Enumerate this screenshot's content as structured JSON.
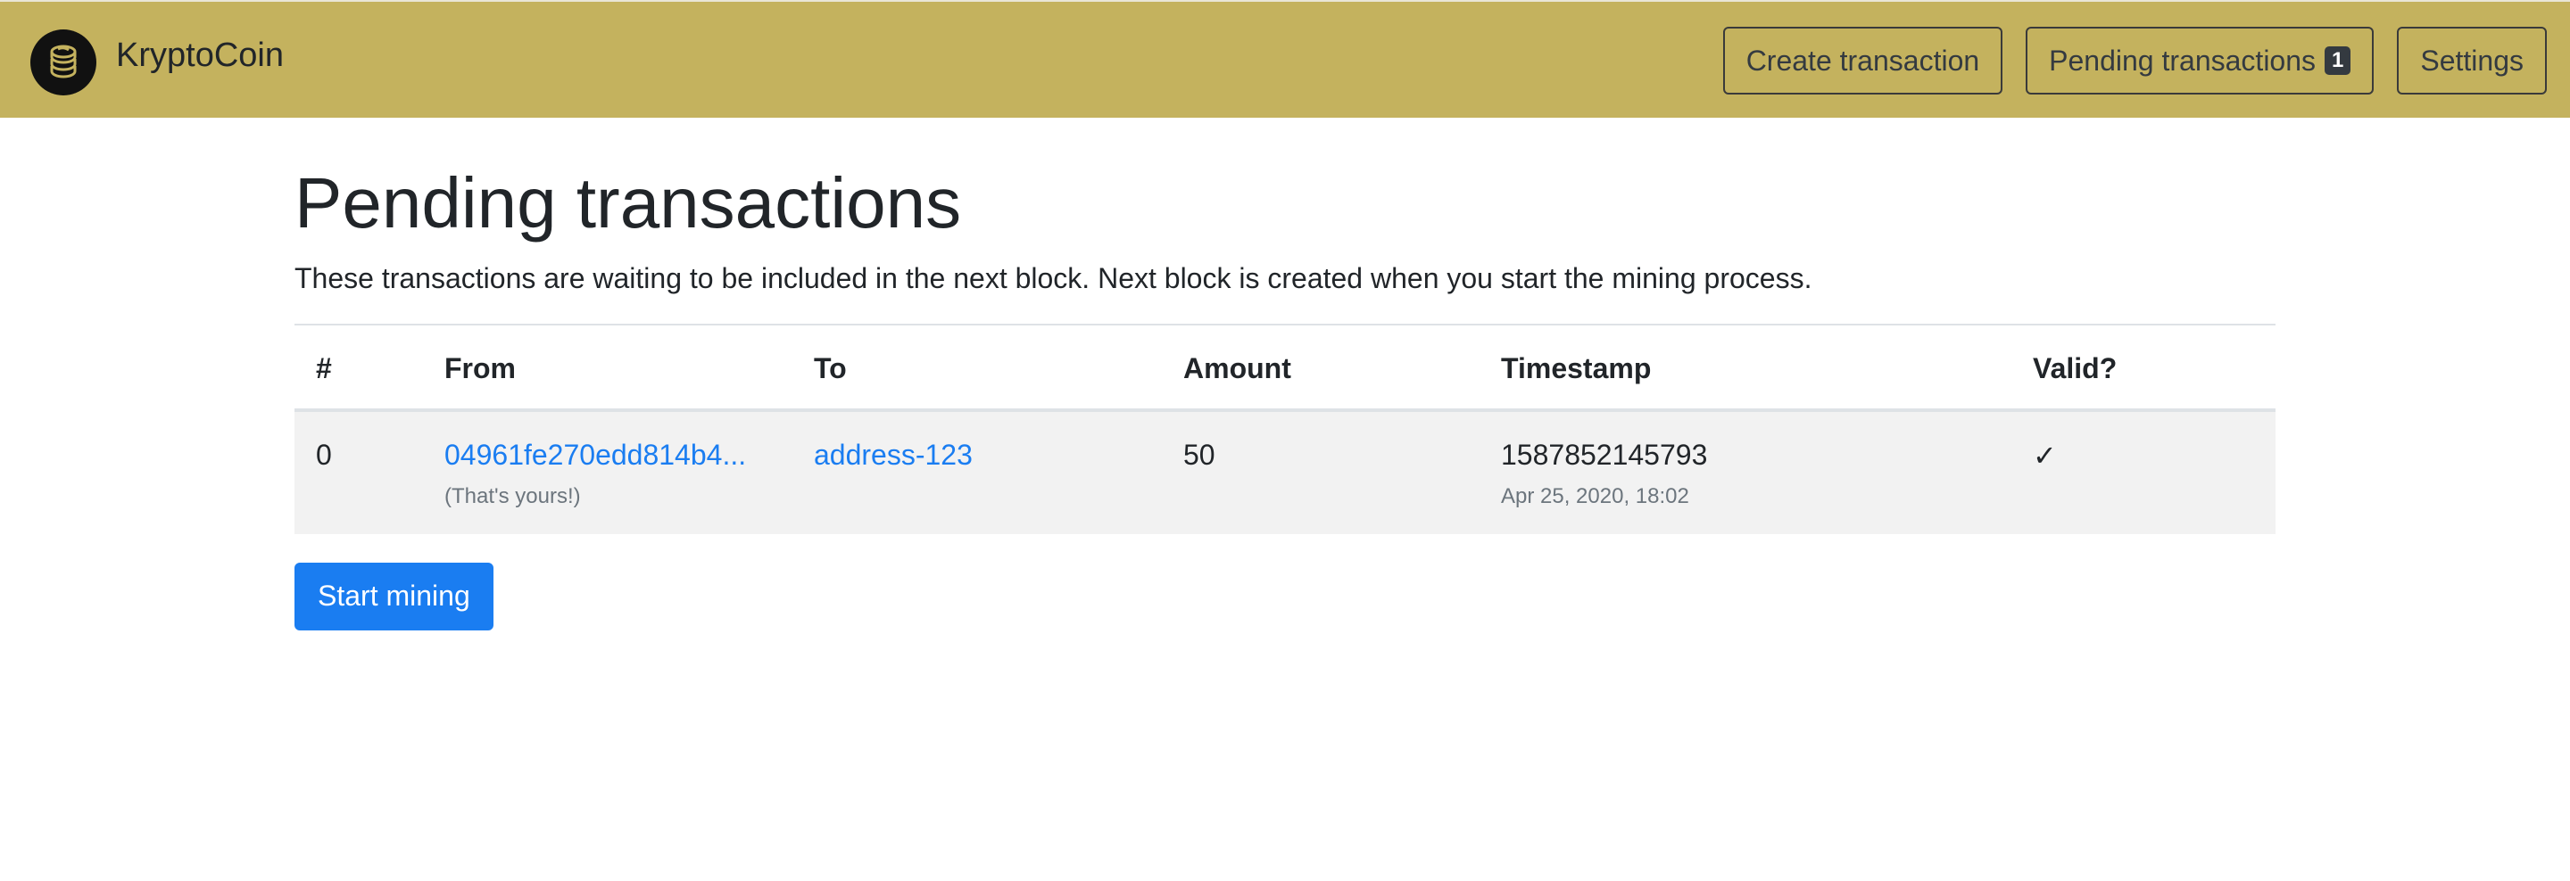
{
  "navbar": {
    "brand": "KryptoCoin",
    "logo_icon": "coin-stack-icon",
    "background_color": "#c4b25e",
    "buttons": {
      "create": "Create transaction",
      "pending": "Pending transactions",
      "pending_count": "1",
      "settings": "Settings"
    }
  },
  "page": {
    "title": "Pending transactions",
    "description": "These transactions are waiting to be included in the next block. Next block is created when you start the mining process."
  },
  "table": {
    "columns": [
      "#",
      "From",
      "To",
      "Amount",
      "Timestamp",
      "Valid?"
    ],
    "rows": [
      {
        "index": "0",
        "from": "04961fe270edd814b4...",
        "from_note": "(That's yours!)",
        "to": "address-123",
        "amount": "50",
        "timestamp": "1587852145793",
        "timestamp_human": "Apr 25, 2020, 18:02",
        "valid": "✓"
      }
    ]
  },
  "actions": {
    "start_mining": "Start mining",
    "primary_color": "#1a7df1"
  }
}
